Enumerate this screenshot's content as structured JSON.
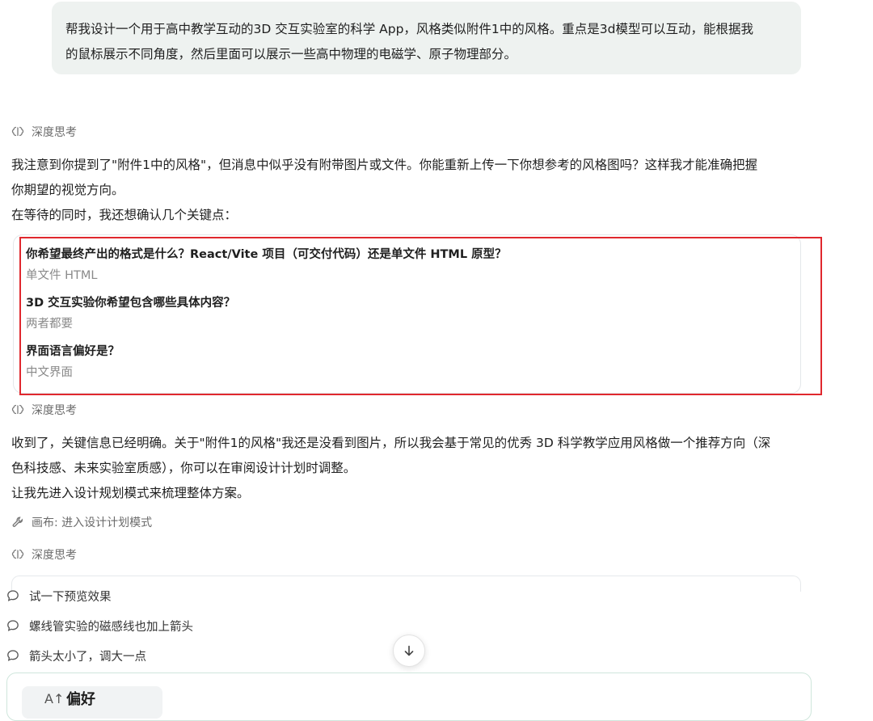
{
  "user_message": {
    "line1": "帮我设计一个用于高中教学互动的3D 交互实验室的科学 App，风格类似附件1中的风格。重点是3d模型可以互动，能根据我",
    "line2": "的鼠标展示不同角度，然后里面可以展示一些高中物理的电磁学、原子物理部分。"
  },
  "thinking_label": "深度思考",
  "assistant_1": {
    "line1": "我注意到你提到了\"附件1中的风格\"，但消息中似乎没有附带图片或文件。你能重新上传一下你想参考的风格图吗？这样我才能准确把握",
    "line2": "你期望的视觉方向。",
    "line3": "在等待的同时，我还想确认几个关键点："
  },
  "qa": [
    {
      "question": "你希望最终产出的格式是什么？React/Vite 项目（可交付代码）还是单文件 HTML 原型？",
      "answer": "单文件 HTML"
    },
    {
      "question": "3D 交互实验你希望包含哪些具体内容？",
      "answer": "两者都要"
    },
    {
      "question": "界面语言偏好是？",
      "answer": "中文界面"
    }
  ],
  "assistant_2": {
    "line1": "收到了，关键信息已经明确。关于\"附件1的风格\"我还是没看到图片，所以我会基于常见的优秀 3D 科学教学应用风格做一个推荐方向（深",
    "line2": "色科技感、未来实验室质感），你可以在审阅设计计划时调整。",
    "line3": "让我先进入设计规划模式来梳理整体方案。"
  },
  "tool_call_label": "画布: 进入设计计划模式",
  "suggestions": [
    "试一下预览效果",
    "螺线管实验的磁感线也加上箭头",
    "箭头太小了，调大一点"
  ],
  "preferences": {
    "title": "偏好",
    "icon_glyph": "A↑"
  },
  "colors": {
    "highlight": "#e0282e",
    "bubble_bg": "#eef2f0",
    "muted_text": "#8a8a8a"
  },
  "icons": {
    "thinking": "brain-icon",
    "tool": "wrench-icon",
    "suggestion": "chat-bubble-icon",
    "scroll": "arrow-down-icon"
  }
}
